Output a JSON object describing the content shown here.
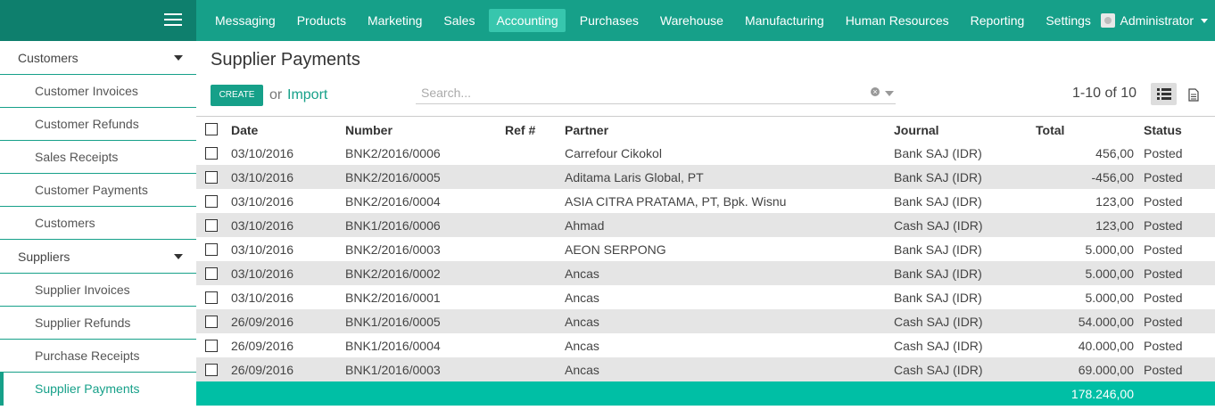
{
  "nav": {
    "menu": [
      "Messaging",
      "Products",
      "Marketing",
      "Sales",
      "Accounting",
      "Purchases",
      "Warehouse",
      "Manufacturing",
      "Human Resources",
      "Reporting",
      "Settings"
    ],
    "active": "Accounting",
    "user": "Administrator"
  },
  "sidebar": {
    "customers_header": "Customers",
    "customers_items": [
      "Customer Invoices",
      "Customer Refunds",
      "Sales Receipts",
      "Customer Payments",
      "Customers"
    ],
    "suppliers_header": "Suppliers",
    "suppliers_items": [
      "Supplier Invoices",
      "Supplier Refunds",
      "Purchase Receipts",
      "Supplier Payments"
    ],
    "active_item": "Supplier Payments"
  },
  "page": {
    "title": "Supplier Payments",
    "create_label": "CREATE",
    "or_label": "or",
    "import_label": "Import",
    "search_placeholder": "Search...",
    "pager": "1-10 of 10"
  },
  "table": {
    "headers": {
      "date": "Date",
      "number": "Number",
      "ref": "Ref #",
      "partner": "Partner",
      "journal": "Journal",
      "total": "Total",
      "status": "Status"
    },
    "rows": [
      {
        "date": "03/10/2016",
        "number": "BNK2/2016/0006",
        "ref": "",
        "partner": "Carrefour Cikokol",
        "journal": "Bank SAJ (IDR)",
        "total": "456,00",
        "status": "Posted"
      },
      {
        "date": "03/10/2016",
        "number": "BNK2/2016/0005",
        "ref": "",
        "partner": "Aditama Laris Global, PT",
        "journal": "Bank SAJ (IDR)",
        "total": "-456,00",
        "status": "Posted"
      },
      {
        "date": "03/10/2016",
        "number": "BNK2/2016/0004",
        "ref": "",
        "partner": "ASIA CITRA PRATAMA, PT, Bpk. Wisnu",
        "journal": "Bank SAJ (IDR)",
        "total": "123,00",
        "status": "Posted"
      },
      {
        "date": "03/10/2016",
        "number": "BNK1/2016/0006",
        "ref": "",
        "partner": "Ahmad",
        "journal": "Cash SAJ (IDR)",
        "total": "123,00",
        "status": "Posted"
      },
      {
        "date": "03/10/2016",
        "number": "BNK2/2016/0003",
        "ref": "",
        "partner": "AEON SERPONG",
        "journal": "Bank SAJ (IDR)",
        "total": "5.000,00",
        "status": "Posted"
      },
      {
        "date": "03/10/2016",
        "number": "BNK2/2016/0002",
        "ref": "",
        "partner": "Ancas",
        "journal": "Bank SAJ (IDR)",
        "total": "5.000,00",
        "status": "Posted"
      },
      {
        "date": "03/10/2016",
        "number": "BNK2/2016/0001",
        "ref": "",
        "partner": "Ancas",
        "journal": "Bank SAJ (IDR)",
        "total": "5.000,00",
        "status": "Posted"
      },
      {
        "date": "26/09/2016",
        "number": "BNK1/2016/0005",
        "ref": "",
        "partner": "Ancas",
        "journal": "Cash SAJ (IDR)",
        "total": "54.000,00",
        "status": "Posted"
      },
      {
        "date": "26/09/2016",
        "number": "BNK1/2016/0004",
        "ref": "",
        "partner": "Ancas",
        "journal": "Cash SAJ (IDR)",
        "total": "40.000,00",
        "status": "Posted"
      },
      {
        "date": "26/09/2016",
        "number": "BNK1/2016/0003",
        "ref": "",
        "partner": "Ancas",
        "journal": "Cash SAJ (IDR)",
        "total": "69.000,00",
        "status": "Posted"
      }
    ],
    "total_sum": "178.246,00"
  },
  "colors": {
    "brand": "#16a089",
    "brand_dark": "#0e7f6d",
    "active_menu": "#37c6ad",
    "footer": "#00bfa5"
  },
  "icons": [
    "hamburger-icon",
    "caret-down-icon",
    "avatar-icon",
    "clear-search-icon",
    "search-dropdown-icon",
    "list-view-icon",
    "form-view-icon"
  ]
}
